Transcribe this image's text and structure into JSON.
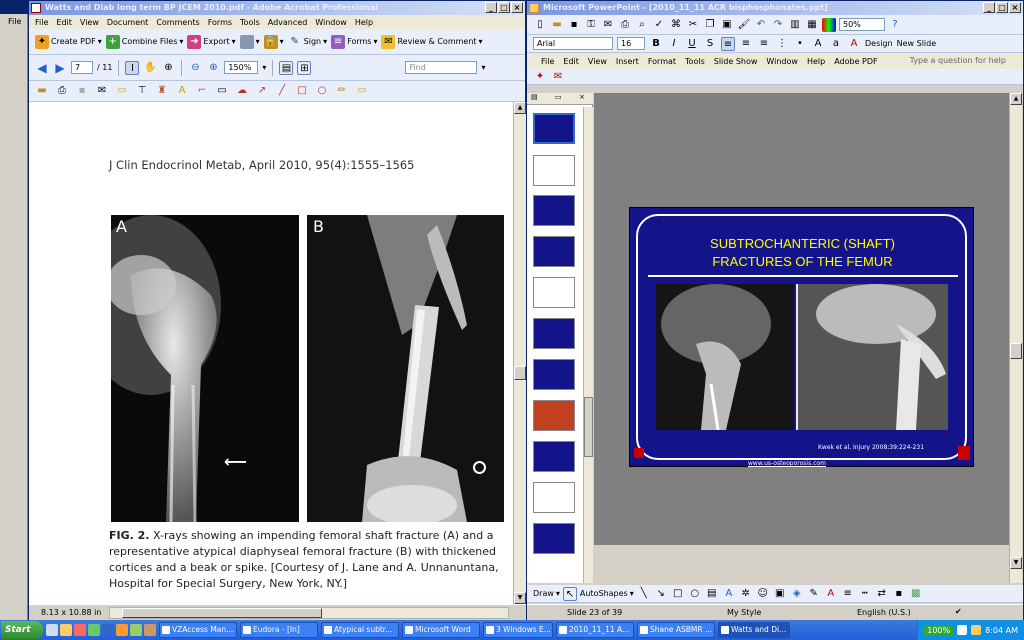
{
  "desktop": {
    "left_strip_labels": [
      "File"
    ]
  },
  "acrobat": {
    "title": "Watts and Diab long term BP JCEM 2010.pdf - Adobe Acrobat Professional",
    "menu": [
      "File",
      "Edit",
      "View",
      "Document",
      "Comments",
      "Forms",
      "Tools",
      "Advanced",
      "Window",
      "Help"
    ],
    "toolbar1": [
      "Create PDF",
      "Combine Files",
      "Export",
      "",
      "",
      "Sign",
      "Forms",
      "Review & Comment"
    ],
    "page_current": "7",
    "page_total": "/ 11",
    "zoom": "150%",
    "find_placeholder": "Find",
    "doc": {
      "citation": "J Clin Endocrinol Metab, April 2010, 95(4):1555–1565",
      "panel_a": "A",
      "panel_b": "B",
      "caption_lead": "FIG. 2.",
      "caption_body": "X-rays showing an impending femoral shaft fracture (A) and a representative atypical diaphyseal femoral fracture (B) with thickened cortices and a beak or spike. [Courtesy of J. Lane and A. Unnanuntana, Hospital for Special Surgery, New York, NY.]"
    },
    "status_size": "8.13 x 10.88 in"
  },
  "powerpoint": {
    "title": "Microsoft PowerPoint - [2010_11_11 ACR bisphosphonates.ppt]",
    "font": "Arial",
    "font_size": "16",
    "zoom": "50%",
    "design_label": "Design",
    "new_slide_label": "New Slide",
    "menu": [
      "File",
      "Edit",
      "View",
      "Insert",
      "Format",
      "Tools",
      "Slide Show",
      "Window",
      "Help",
      "Adobe PDF"
    ],
    "help_placeholder": "Type a question for help",
    "slide": {
      "title_line1": "SUBTROCHANTERIC (SHAFT)",
      "title_line2": "FRACTURES OF THE FEMUR",
      "citation": "Kwek et al, Injury 2008;39:224-231",
      "url": "www.us-osteoporosis.com"
    },
    "draw_label": "Draw",
    "autoshapes_label": "AutoShapes",
    "status": {
      "slide": "Slide 23 of 39",
      "design": "My Style",
      "language": "English (U.S.)"
    }
  },
  "taskbar": {
    "start": "Start",
    "tasks": [
      "VZAccess Man...",
      "Eudora - [In]",
      "Atypical subtr...",
      "Microsoft Word",
      "3 Windows E...",
      "2010_11_11 A...",
      "Shane ASBMR ...",
      "Watts and Di..."
    ],
    "battery": "100%",
    "time": "8:04 AM"
  },
  "colors": {
    "slide_bg": "#14148a",
    "slide_title": "#ffff00",
    "titlebar_active": "#0a246a"
  }
}
